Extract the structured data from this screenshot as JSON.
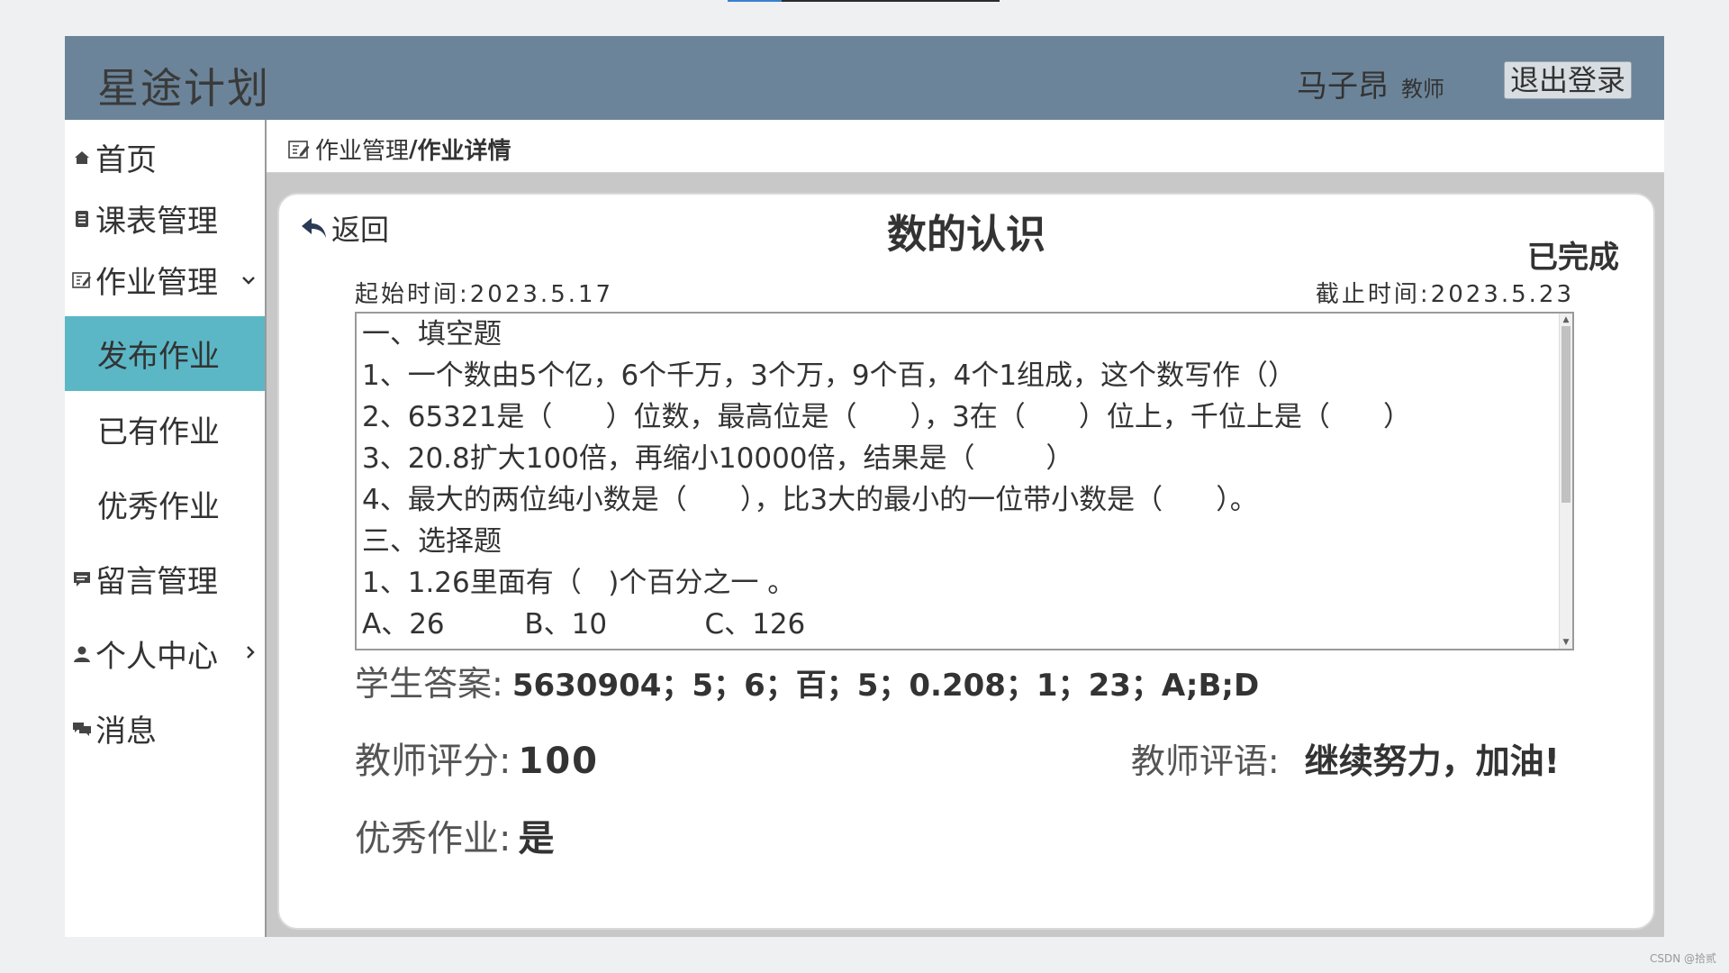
{
  "header": {
    "brand": "星途计划",
    "user_name": "马子昂",
    "user_role": "教师",
    "logout_label": "退出登录"
  },
  "sidebar": {
    "items": [
      {
        "label": "首页",
        "icon": "home-icon"
      },
      {
        "label": "课表管理",
        "icon": "schedule-icon"
      },
      {
        "label": "作业管理",
        "icon": "edit-icon",
        "expanded": true
      },
      {
        "label": "发布作业",
        "active": true
      },
      {
        "label": "已有作业"
      },
      {
        "label": "优秀作业"
      },
      {
        "label": "留言管理",
        "icon": "message-icon"
      },
      {
        "label": "个人中心",
        "icon": "user-icon"
      },
      {
        "label": "消息",
        "icon": "chat-icon"
      }
    ]
  },
  "breadcrumb": {
    "parent": "作业管理",
    "separator": "/",
    "current": "作业详情"
  },
  "detail": {
    "back_label": "返回",
    "title": "数的认识",
    "status": "已完成",
    "start_time": "起始时间:2023.5.17",
    "end_time": "截止时间:2023.5.23",
    "content_lines": [
      "一、填空题",
      "1、一个数由5个亿，6个千万，3个万，9个百，4个1组成，这个数写作（）",
      "2、65321是（      ）位数，最高位是（      ），3在（      ）位上，千位上是（      ）",
      "3、20.8扩大100倍，再缩小10000倍，结果是（        ）",
      "4、最大的两位纯小数是（      ），比3大的最小的一位带小数是（      ）。",
      "三、选择题",
      "1、1.26里面有（   )个百分之一 。",
      "A、26         B、10           C、126"
    ],
    "answer_label": "学生答案:",
    "answer_value": "5630904；5；6；百；5；0.208；1；23；A;B;D",
    "score_label": "教师评分:",
    "score_value": "100",
    "comment_label": "教师评语:",
    "comment_value": "继续努力，加油!",
    "excellent_label": "优秀作业:",
    "excellent_value": "是"
  },
  "watermark": "CSDN @拾贰",
  "colors": {
    "header_bg": "#6b8499",
    "active_nav": "#5bb7c6",
    "page_bg": "#eef0f2"
  }
}
